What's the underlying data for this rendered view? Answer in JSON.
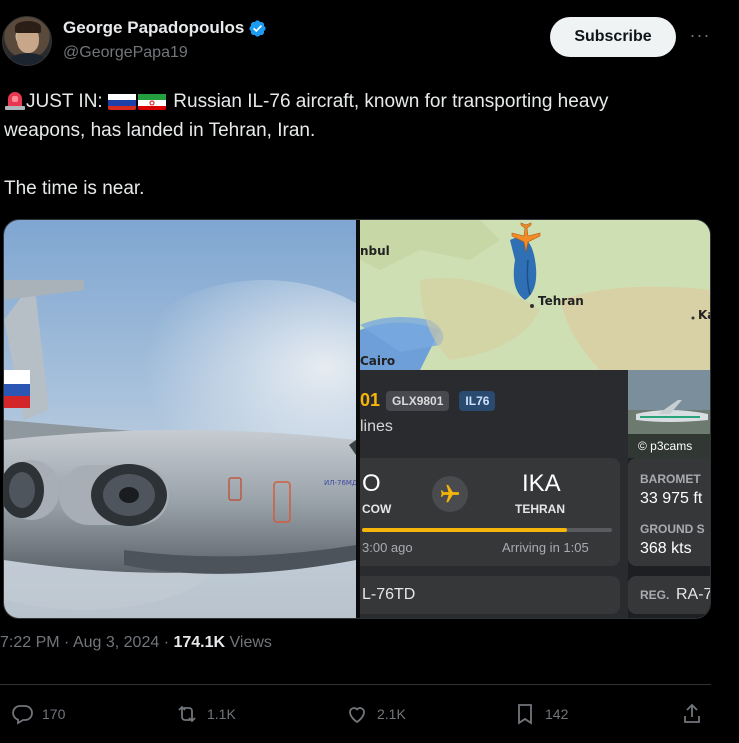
{
  "author": {
    "name": "George Papadopoulos",
    "handle": "@GeorgePapa19",
    "verified_color": "#1d9bf0"
  },
  "subscribe_label": "Subscribe",
  "more_label": "···",
  "tweet": {
    "line1_prefix": "JUST IN:",
    "line1_rest": "Russian IL-76 aircraft, known for transporting heavy",
    "line2": "weapons, has landed in Tehran, Iran.",
    "line3": "The time is near."
  },
  "media": {
    "map_labels": {
      "istanbul": "nbul",
      "tehran": "Tehran",
      "cairo": "Cairo",
      "ka": "Ka"
    },
    "flight": {
      "flight_number_partial": "01",
      "callsign": "GLX9801",
      "aircraft_code": "IL76",
      "airline_partial": "lines",
      "photo_credit": "© p3cams",
      "origin_code_partial": "O",
      "origin_city_partial": "COW",
      "destination_code": "IKA",
      "destination_city": "TEHRAN",
      "departed": "3:00 ago",
      "arriving": "Arriving in 1:05",
      "progress": 0.82,
      "aircraft_type": "L-76TD",
      "baro_label": "BAROMET",
      "baro_value": "33 975 ft",
      "ground_speed_label": "GROUND S",
      "ground_speed_value": "368 kts",
      "reg_label": "REG.",
      "reg_value": "RA-7"
    }
  },
  "stats": {
    "time": "7:22 PM",
    "dot1": "·",
    "date": "Aug 3, 2024",
    "dot2": "·",
    "views_count": "174.1K",
    "views_label": "Views"
  },
  "actions": {
    "replies": "170",
    "reposts": "1.1K",
    "likes": "2.1K",
    "bookmarks": "142"
  }
}
